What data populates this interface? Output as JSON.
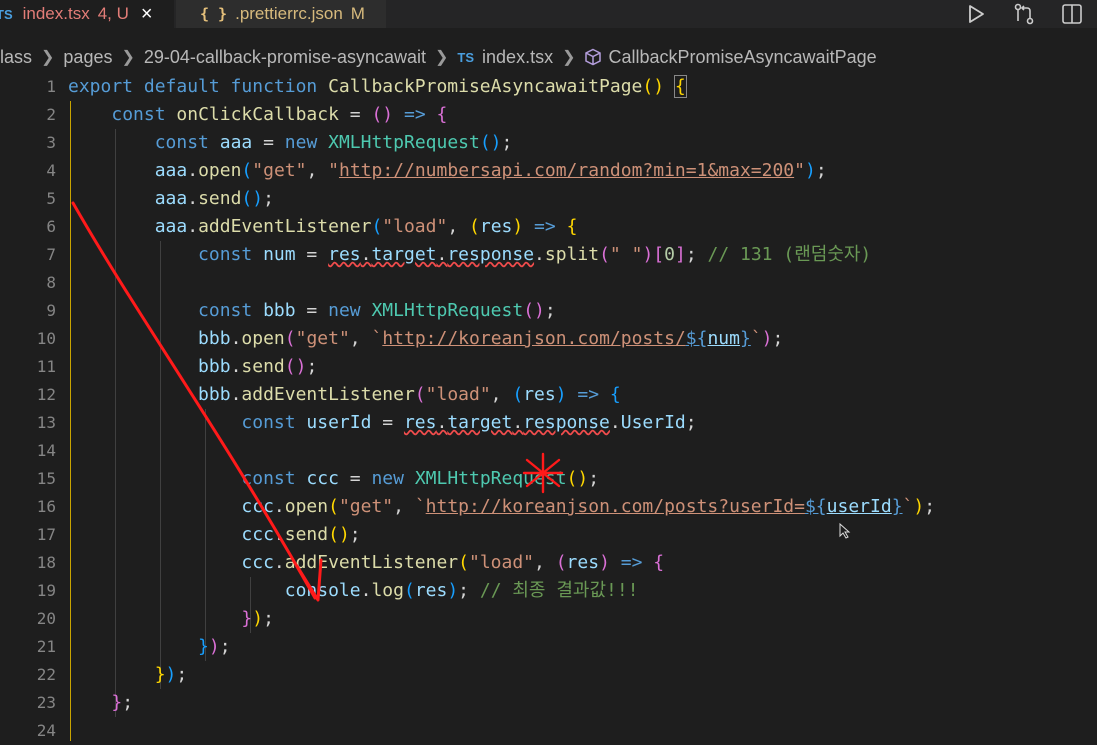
{
  "tabs": [
    {
      "icon": "TS",
      "name": "index.tsx",
      "status": "4, U",
      "close": "×",
      "active": true
    },
    {
      "icon": "{ }",
      "name": ".prettierrc.json",
      "status": "M",
      "active": false
    }
  ],
  "breadcrumb": {
    "items": [
      "lass",
      "pages",
      "29-04-callback-promise-asyncawait"
    ],
    "file_icon": "TS",
    "file": "index.tsx",
    "symbol": "CallbackPromiseAsyncawaitPage"
  },
  "line_numbers": [
    "1",
    "2",
    "3",
    "4",
    "5",
    "6",
    "7",
    "8",
    "9",
    "10",
    "11",
    "12",
    "13",
    "14",
    "15",
    "16",
    "17",
    "18",
    "19",
    "20",
    "21",
    "22",
    "23",
    "24"
  ],
  "code": {
    "l1": {
      "a": "export default function ",
      "b": "CallbackPromiseAsyncawaitPage",
      "c": "()",
      " d": "",
      "e": "{"
    },
    "l2": {
      "a": "const ",
      "b": "onClickCallback",
      "c": " = ",
      "d": "()",
      "e": " => ",
      "f": "{"
    },
    "l3": {
      "a": "const ",
      "b": "aaa",
      "c": " = ",
      "d": "new ",
      "e": "XMLHttpRequest",
      "f": "()",
      "g": ";"
    },
    "l4": {
      "a": "aaa",
      "b": ".",
      "c": "open",
      "d": "(",
      "e": "\"get\"",
      "f": ", ",
      "g": "\"",
      "h": "http://numbersapi.com/random?min=1&max=200",
      "i": "\"",
      "j": ")",
      "k": ";"
    },
    "l5": {
      "a": "aaa",
      "b": ".",
      "c": "send",
      "d": "()",
      "e": ";"
    },
    "l6": {
      "a": "aaa",
      "b": ".",
      "c": "addEventListener",
      "d": "(",
      "e": "\"load\"",
      "f": ", ",
      "g": "(",
      "h": "res",
      "i": ")",
      "j": " => ",
      "k": "{"
    },
    "l7": {
      "a": "const ",
      "b": "num",
      "c": " = ",
      "d": "res",
      "e": ".",
      "f": "target",
      "g": ".",
      "h": "response",
      "i": ".",
      "j": "split",
      "k": "(",
      "l": "\" \"",
      "m": ")",
      "n": "[",
      "o": "0",
      "p": "]",
      "q": "; ",
      "r": "// 131 (랜덤숫자)"
    },
    "l9": {
      "a": "const ",
      "b": "bbb",
      "c": " = ",
      "d": "new ",
      "e": "XMLHttpRequest",
      "f": "()",
      "g": ";"
    },
    "l10": {
      "a": "bbb",
      "b": ".",
      "c": "open",
      "d": "(",
      "e": "\"get\"",
      "f": ", ",
      "g": "`",
      "h": "http://koreanjson.com/posts/",
      "i": "${",
      "j": "num",
      "k": "}",
      "l": "`",
      "m": ")",
      "n": ";"
    },
    "l11": {
      "a": "bbb",
      "b": ".",
      "c": "send",
      "d": "()",
      "e": ";"
    },
    "l12": {
      "a": "bbb",
      "b": ".",
      "c": "addEventListener",
      "d": "(",
      "e": "\"load\"",
      "f": ", ",
      "g": "(",
      "h": "res",
      "i": ")",
      "j": " => ",
      "k": "{"
    },
    "l13": {
      "a": "const ",
      "b": "userId",
      "c": " = ",
      "d": "res",
      "e": ".",
      "f": "target",
      "g": ".",
      "h": "response",
      "i": ".",
      "j": "UserId",
      "k": ";"
    },
    "l15": {
      "a": "const ",
      "b": "ccc",
      "c": " = ",
      "d": "new ",
      "e": "XMLHttpRequest",
      "f": "()",
      "g": ";"
    },
    "l16": {
      "a": "ccc",
      "b": ".",
      "c": "open",
      "d": "(",
      "e": "\"get\"",
      "f": ", ",
      "g": "`",
      "h": "http://koreanjson.com/posts?userId=",
      "i": "${",
      "j": "userId",
      "k": "}",
      "l": "`",
      "m": ")",
      "n": ";"
    },
    "l17": {
      "a": "ccc",
      "b": ".",
      "c": "send",
      "d": "()",
      "e": ";"
    },
    "l18": {
      "a": "ccc",
      "b": ".",
      "c": "addEventListener",
      "d": "(",
      "e": "\"load\"",
      "f": ", ",
      "g": "(",
      "h": "res",
      "i": ")",
      "j": " => ",
      "k": "{"
    },
    "l19": {
      "a": "console",
      "b": ".",
      "c": "log",
      "d": "(",
      "e": "res",
      "f": ")",
      "g": "; ",
      "h": "// 최종 결과값!!!"
    },
    "l20": {
      "a": "}",
      "b": ")",
      "c": ";"
    },
    "l21": {
      "a": "}",
      "b": ")",
      "c": ";"
    },
    "l22": {
      "a": "}",
      "b": ")",
      "c": ";"
    },
    "l23": {
      "a": "}",
      "b": ";"
    }
  },
  "colors": {
    "background": "#1e1e1e",
    "annotation": "#ff1a1a",
    "indent_guide_active": "#c8a400"
  }
}
